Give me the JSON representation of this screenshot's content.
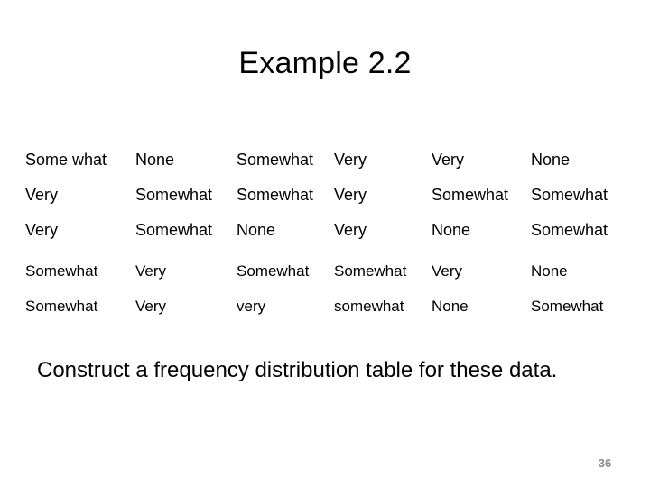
{
  "slide": {
    "title": "Example 2.2",
    "prompt": "Construct a frequency distribution table for these data.",
    "page_number": "36",
    "text_color": "#000000",
    "page_number_color": "#8a8a8a",
    "background_color": "#ffffff"
  },
  "table": {
    "columns": 6,
    "upper_block": [
      [
        "Some what",
        "None",
        "Somewhat",
        "Very",
        "Very",
        "None"
      ],
      [
        "Very",
        "Somewhat",
        "Somewhat",
        "Very",
        "Somewhat",
        "Somewhat"
      ],
      [
        "Very",
        "Somewhat",
        "None",
        "Very",
        "None",
        "Somewhat"
      ]
    ],
    "lower_block": [
      [
        "Somewhat",
        "Very",
        "Somewhat",
        "Somewhat",
        "Very",
        "None"
      ],
      [
        "Somewhat",
        "Very",
        "very",
        "somewhat",
        "None",
        "Somewhat"
      ]
    ]
  }
}
